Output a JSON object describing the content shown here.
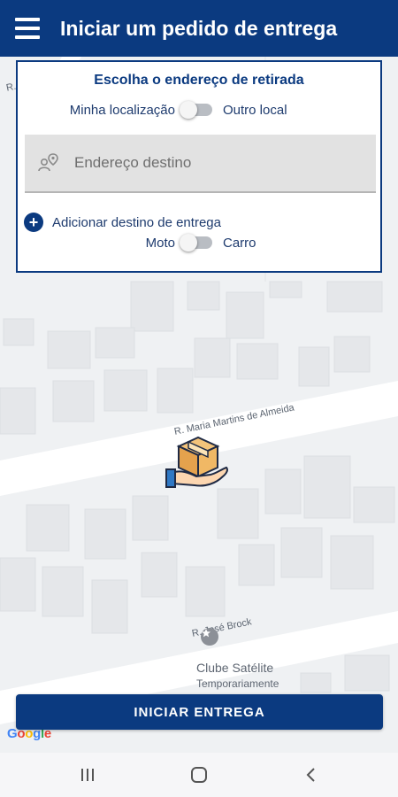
{
  "app_bar": {
    "title": "Iniciar um pedido de entrega",
    "menu_icon": "hamburger-menu-icon"
  },
  "pickup_panel": {
    "title": "Escolha o endereço de retirada",
    "location_toggle": {
      "left_label": "Minha localização",
      "right_label": "Outro local",
      "state": "left"
    },
    "destination_field": {
      "placeholder": "Endereço destino",
      "icon": "location-pin-person-icon"
    },
    "add_destination": {
      "label": "Adicionar destino de entrega",
      "icon": "plus-circle-icon"
    },
    "vehicle_toggle": {
      "left_label": "Moto",
      "right_label": "Carro",
      "state": "left"
    }
  },
  "map": {
    "street_labels": [
      "R. Maria Martins de Almeida",
      "R. José Brock",
      "R."
    ],
    "poi": {
      "name": "Clube Satélite",
      "status": "Temporariamente"
    },
    "center_marker": "delivery-box-hand-icon",
    "attribution": "Google"
  },
  "primary_button": {
    "label": "INICIAR ENTREGA"
  },
  "system_nav": {
    "buttons": [
      "recent-apps-icon",
      "home-icon",
      "back-icon"
    ]
  },
  "colors": {
    "brand_blue": "#0b3a80",
    "map_background": "#eff1f3",
    "field_background": "#e2e2e2"
  }
}
